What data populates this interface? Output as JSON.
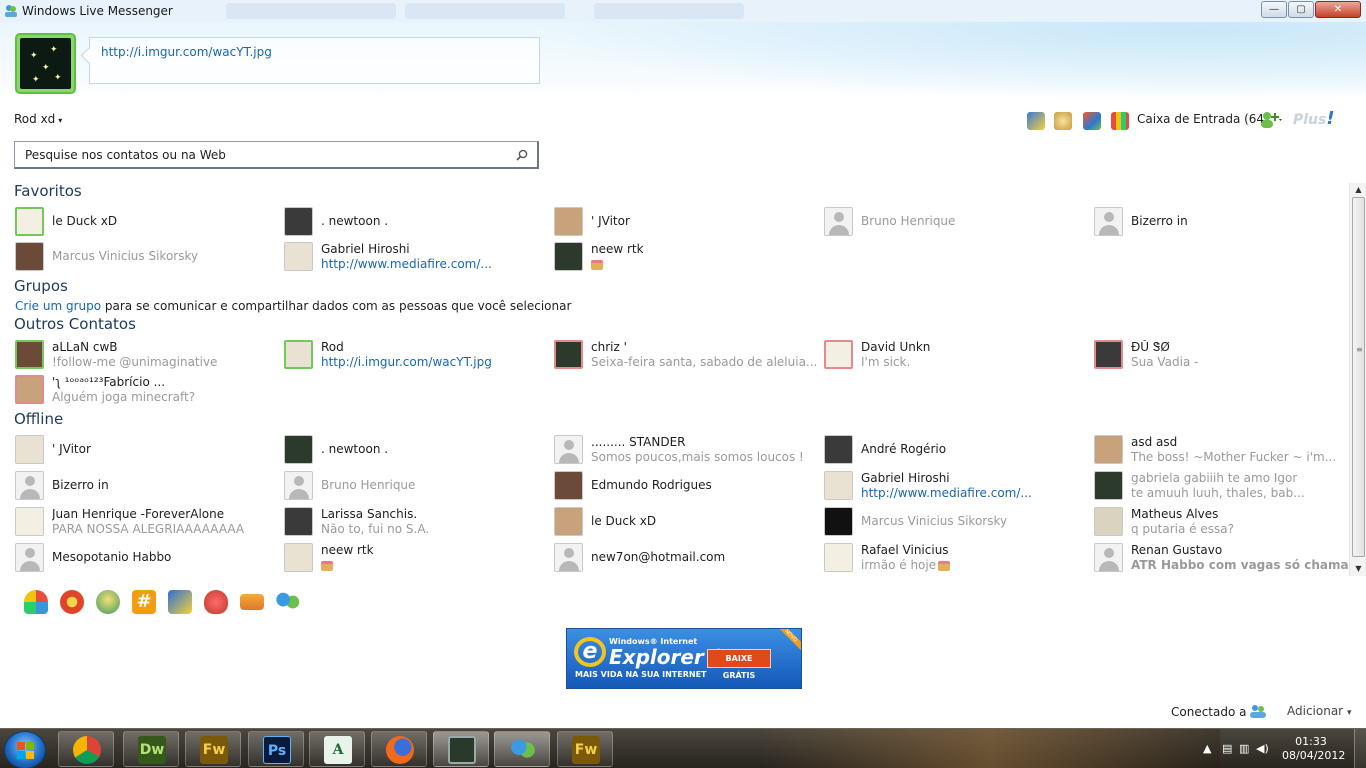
{
  "window": {
    "title": "Windows Live Messenger",
    "controls": {
      "minimize": "—",
      "maximize": "▢",
      "close": "✕"
    }
  },
  "profile": {
    "personal_message": "http://i.imgur.com/wacYT.jpg",
    "user_name": "Rod xd",
    "user_caret": "▾",
    "inbox_label": "Caixa de Entrada (64)",
    "plus_logo": "Plus",
    "plus_mark": "!"
  },
  "search": {
    "placeholder": "Pesquise nos contatos ou na Web"
  },
  "sections": {
    "favoritos": "Favoritos",
    "grupos": "Grupos",
    "grupos_link": "Crie um grupo",
    "grupos_text": " para se comunicar e compartilhar dados com as pessoas que você selecionar",
    "outros": "Outros Contatos",
    "offline": "Offline"
  },
  "favoritos": [
    {
      "name": "le Duck xD",
      "status": "",
      "state": "online"
    },
    {
      "name": ". newtoon .",
      "status": "",
      "state": "offline"
    },
    {
      "name": "' JVitor",
      "status": "",
      "state": "offline"
    },
    {
      "name": "Bruno Henrique",
      "status": "",
      "state": "muted"
    },
    {
      "name": "Bizerro in",
      "status": "",
      "state": "offline"
    },
    {
      "name": "Marcus Vinicius Sikorsky",
      "status": "",
      "state": "muted"
    },
    {
      "name": "Gabriel Hiroshi",
      "status": "http://www.mediafire.com/...",
      "state": "offline",
      "status_kind": "link"
    },
    {
      "name": "neew rtk",
      "status": "",
      "state": "offline",
      "cake": true
    }
  ],
  "outros": [
    {
      "name": "aLLaN cwB",
      "status": "!follow-me @unimaginative",
      "state": "online"
    },
    {
      "name": "Rod",
      "status": "http://i.imgur.com/wacYT.jpg",
      "state": "online",
      "status_kind": "link"
    },
    {
      "name": "chriz '",
      "status": "Seixa-feira santa, sabado de aleluia...",
      "state": "away"
    },
    {
      "name": "David Unkn",
      "status": "I'm sick.",
      "state": "away"
    },
    {
      "name": "ĐŬ ᏕØ",
      "status": "Sua Vadia -",
      "state": "away"
    },
    {
      "name": "'ʅ ¹ᵒᵒᵃᵒ¹²³Fabrício ...",
      "status": "Alguém joga minecraft?",
      "state": "away"
    }
  ],
  "offline": [
    {
      "name": "' JVitor",
      "status": ""
    },
    {
      "name": ". newtoon .",
      "status": ""
    },
    {
      "name": "......... STANDER",
      "status": "Somos poucos,mais somos loucos !"
    },
    {
      "name": "André Rogério",
      "status": ""
    },
    {
      "name": "asd asd",
      "status": "The boss! ~Mother Fucker ~ i'm..."
    },
    {
      "name": "Bizerro in",
      "status": ""
    },
    {
      "name": "Bruno Henrique",
      "status": "",
      "muted": true
    },
    {
      "name": "Edmundo Rodrigues",
      "status": ""
    },
    {
      "name": "Gabriel Hiroshi",
      "status": "http://www.mediafire.com/...",
      "status_kind": "link"
    },
    {
      "name": "gabriela gabiiih te amo Igor",
      "status": "te amuuh luuh, thales,            bab...",
      "muted": true
    },
    {
      "name": "Juan Henrique -ForeverAlone",
      "status": "PARA NOSSA ALEGRIAAAAAAAA"
    },
    {
      "name": "Larissa Sanchis.",
      "status": "Não to, fui no S.A."
    },
    {
      "name": "le Duck xD",
      "status": ""
    },
    {
      "name": "Marcus Vinicius Sikorsky",
      "status": "",
      "muted": true
    },
    {
      "name": "Matheus Alves",
      "status": "q putaria é essa?"
    },
    {
      "name": "Mesopotanio Habbo",
      "status": ""
    },
    {
      "name": "neew rtk",
      "status": "",
      "cake": true
    },
    {
      "name": "new7on@hotmail.com",
      "status": ""
    },
    {
      "name": "Rafael Vinicius",
      "status": "irmão é hoje",
      "cake": true
    },
    {
      "name": "Renan Gustavo",
      "status": "ATR Habbo com vagas só chama...",
      "status_kind": "bold"
    }
  ],
  "ad": {
    "brand_small": "Windows® Internet",
    "brand": "Explorer 9",
    "cta": "BAIXE GRÁTIS",
    "tagline": "MAIS VIDA NA SUA INTERNET",
    "corner": "NOVO"
  },
  "footer": {
    "connected": "Conectado a",
    "add": "Adicionar",
    "add_caret": "▾"
  },
  "taskbar": {
    "apps": [
      "Chrome",
      "Dw",
      "Fw",
      "Ps",
      "A",
      "Firefox",
      "Monitor",
      "Messenger",
      "Fw"
    ],
    "clock_time": "01:33",
    "clock_date": "08/04/2012"
  },
  "colors": {
    "online": "#73c85a",
    "away": "#e48a8a",
    "link": "#1766b5",
    "section": "#1e3a5a"
  }
}
